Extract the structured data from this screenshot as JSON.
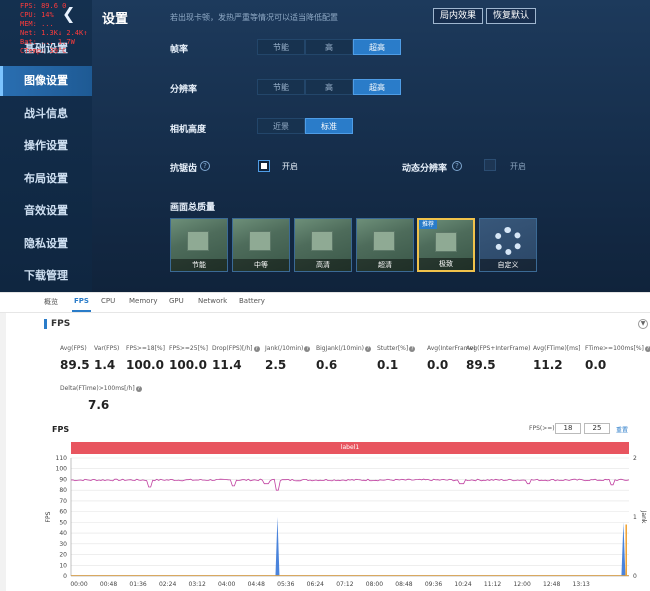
{
  "game": {
    "title": "设置",
    "hint": "若出现卡顿，发热严重等情况可以适当降低配置",
    "buttons": {
      "local_effect": "局内效果",
      "restore_default": "恢复默认"
    },
    "overlay": [
      "FPS: 89.6  0",
      "CPU: 14%",
      "MEM: ...",
      "Net: 1.3K↓  2.4K↑",
      "Bat: ...  1.7W",
      "CTemp: 39°C"
    ],
    "sidebar": [
      {
        "label": "基础设置",
        "active": false
      },
      {
        "label": "图像设置",
        "active": true
      },
      {
        "label": "战斗信息",
        "active": false
      },
      {
        "label": "操作设置",
        "active": false
      },
      {
        "label": "布局设置",
        "active": false
      },
      {
        "label": "音效设置",
        "active": false
      },
      {
        "label": "隐私设置",
        "active": false
      },
      {
        "label": "下载管理",
        "active": false
      }
    ],
    "frame_rate": {
      "label": "帧率",
      "options": [
        "节能",
        "高",
        "超高"
      ],
      "selected": 2
    },
    "resolution": {
      "label": "分辨率",
      "options": [
        "节能",
        "高",
        "超高"
      ],
      "selected": 2
    },
    "camera": {
      "label": "相机高度",
      "options": [
        "近景",
        "标准"
      ],
      "selected": 1
    },
    "anti_alias": {
      "label": "抗锯齿",
      "toggle": "开启",
      "on": true
    },
    "dynamic_res": {
      "label": "动态分辨率",
      "toggle": "开启",
      "on": false
    },
    "quality": {
      "label": "画面总质量",
      "presets": [
        {
          "caption": "节能",
          "tag": ""
        },
        {
          "caption": "中等",
          "tag": ""
        },
        {
          "caption": "高清",
          "tag": ""
        },
        {
          "caption": "超清",
          "tag": ""
        },
        {
          "caption": "极致",
          "tag": "推荐"
        },
        {
          "caption": "自定义",
          "tag": ""
        }
      ],
      "selected": 4
    }
  },
  "tool": {
    "tabs": [
      {
        "label": "概览",
        "active": false
      },
      {
        "label": "FPS",
        "active": true
      },
      {
        "label": "CPU",
        "active": false
      },
      {
        "label": "Memory",
        "active": false
      },
      {
        "label": "GPU",
        "active": false
      },
      {
        "label": "Network",
        "active": false
      },
      {
        "label": "Battery",
        "active": false
      }
    ],
    "section_title": "FPS",
    "stats": [
      {
        "label": "Avg(FPS)",
        "value": "89.5"
      },
      {
        "label": "Var(FPS)",
        "value": "1.4"
      },
      {
        "label": "FPS>=18[%]",
        "value": "100.0"
      },
      {
        "label": "FPS>=25[%]",
        "value": "100.0"
      },
      {
        "label": "Drop(FPS)[/h]",
        "value": "11.4"
      },
      {
        "label": "Jank(/10min)",
        "value": "2.5"
      },
      {
        "label": "BigJank(/10min)",
        "value": "0.6"
      },
      {
        "label": "Stutter[%]",
        "value": "0.1"
      },
      {
        "label": "Avg(InterFrame)",
        "value": "0.0"
      },
      {
        "label": "Avg(FPS+InterFrame)",
        "value": "89.5"
      },
      {
        "label": "Avg(FTime)[ms]",
        "value": "11.2"
      },
      {
        "label": "FTime>=100ms[%]",
        "value": "0.0"
      },
      {
        "label": "Delta(FTime)>100ms[/h]",
        "value": "7.6"
      }
    ],
    "chart_title": "FPS",
    "fps_filter_label": "FPS(>=)",
    "fps_filter_values": [
      "18",
      "25"
    ],
    "reset_label": "重置",
    "label_bar": "label1"
  },
  "chart_data": {
    "type": "line",
    "title": "FPS",
    "ylabel": "FPS",
    "ylabel_right": "Jank",
    "ylim": [
      0,
      110
    ],
    "yticks": [
      0,
      10,
      20,
      30,
      40,
      50,
      60,
      70,
      80,
      90,
      100,
      110
    ],
    "ylim_right": [
      0,
      2
    ],
    "yticks_right": [
      0,
      1,
      2
    ],
    "x": [
      "00:00",
      "00:48",
      "01:36",
      "02:24",
      "03:12",
      "04:00",
      "04:48",
      "05:36",
      "06:24",
      "07:12",
      "08:00",
      "08:48",
      "09:36",
      "10:24",
      "11:12",
      "12:00",
      "12:48",
      "13:13"
    ],
    "series": [
      {
        "name": "FPS",
        "color": "#c040a0",
        "baseline": 89.5,
        "dips": [
          [
            0.14,
            83
          ],
          [
            0.29,
            84
          ],
          [
            0.35,
            86
          ],
          [
            0.37,
            80
          ],
          [
            0.7,
            86
          ],
          [
            0.82,
            86
          ],
          [
            0.97,
            85
          ]
        ]
      },
      {
        "name": "Jank",
        "color": "#2a6fd6",
        "spikes": [
          [
            0.37,
            55
          ],
          [
            0.99,
            50
          ]
        ]
      },
      {
        "name": "BigJank",
        "color": "#f0a030",
        "spikes": [
          [
            0.995,
            48
          ]
        ]
      }
    ],
    "grid": true
  }
}
